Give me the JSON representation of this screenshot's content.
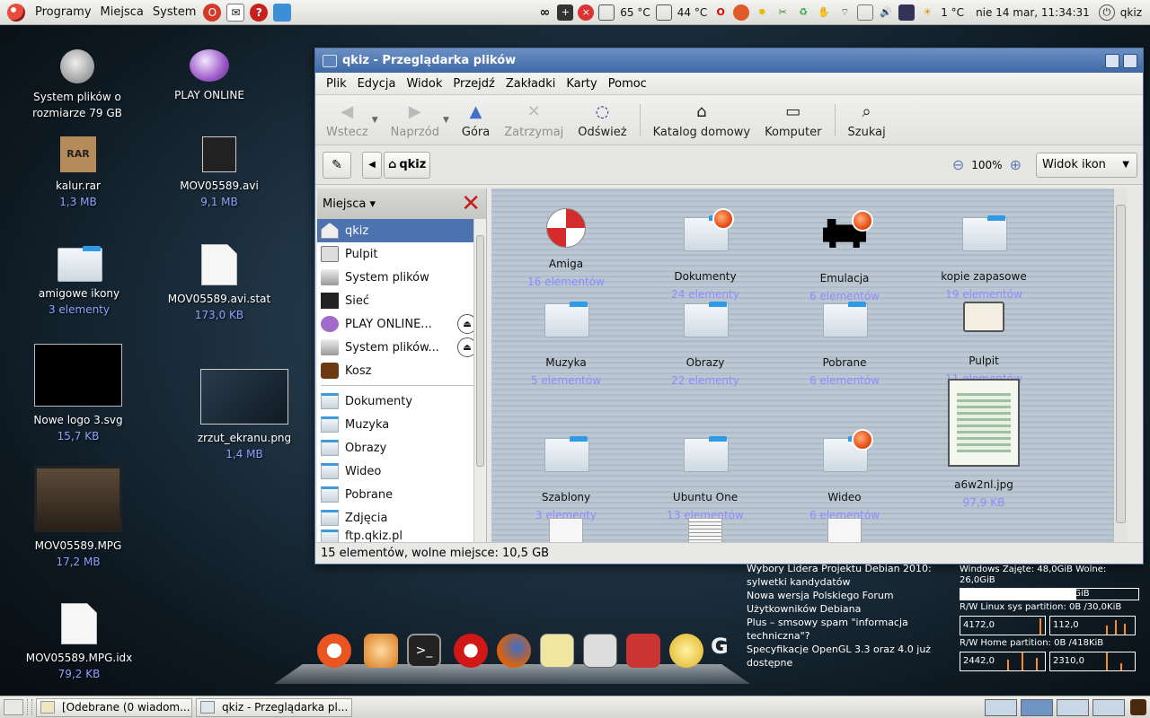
{
  "top_panel": {
    "menus": [
      "Programy",
      "Miejsca",
      "System"
    ],
    "temp1": "65 °C",
    "temp2": "44 °C",
    "weather": "1 °C",
    "clock": "nie 14 mar, 11:34:31",
    "user": "qkiz"
  },
  "desktop": {
    "icons": [
      {
        "label": "System plików o rozmiarze 79 GB",
        "sub": ""
      },
      {
        "label": "PLAY ONLINE",
        "sub": ""
      },
      {
        "label": "kalur.rar",
        "sub": "1,3 MB",
        "icon_text": "RAR"
      },
      {
        "label": "MOV05589.avi",
        "sub": "9,1 MB"
      },
      {
        "label": "amigowe ikony",
        "sub": "3 elementy"
      },
      {
        "label": "MOV05589.avi.stat",
        "sub": "173,0 KB"
      },
      {
        "label": "Nowe logo 3.svg",
        "sub": "15,7 KB"
      },
      {
        "label": "zrzut_ekranu.png",
        "sub": "1,4 MB"
      },
      {
        "label": "MOV05589.MPG",
        "sub": "17,2 MB"
      },
      {
        "label": "MOV05589.MPG.idx",
        "sub": "79,2 KB"
      }
    ]
  },
  "file_manager": {
    "title": "qkiz - Przeglądarka plików",
    "menu": [
      "Plik",
      "Edycja",
      "Widok",
      "Przejdź",
      "Zakładki",
      "Karty",
      "Pomoc"
    ],
    "toolbar": {
      "back": "Wstecz",
      "forward": "Naprzód",
      "up": "Góra",
      "stop": "Zatrzymaj",
      "reload": "Odśwież",
      "home": "Katalog domowy",
      "computer": "Komputer",
      "search": "Szukaj"
    },
    "location": {
      "path": "qkiz",
      "zoom": "100%",
      "view": "Widok ikon"
    },
    "sidebar": {
      "header": "Miejsca",
      "items": [
        {
          "label": "qkiz"
        },
        {
          "label": "Pulpit"
        },
        {
          "label": "System plików"
        },
        {
          "label": "Sieć"
        },
        {
          "label": "PLAY ONLINE..."
        },
        {
          "label": "System plików..."
        },
        {
          "label": "Kosz"
        },
        {
          "label": "Dokumenty"
        },
        {
          "label": "Muzyka"
        },
        {
          "label": "Obrazy"
        },
        {
          "label": "Wideo"
        },
        {
          "label": "Pobrane"
        },
        {
          "label": "Zdjęcia"
        },
        {
          "label": "ftp.qkiz.pl"
        }
      ]
    },
    "items": [
      {
        "name": "Amiga",
        "info": "16 elementów"
      },
      {
        "name": "Dokumenty",
        "info": "24 elementy"
      },
      {
        "name": "Emulacja",
        "info": "6 elementów"
      },
      {
        "name": "kopie zapasowe",
        "info": "19 elementów"
      },
      {
        "name": "Muzyka",
        "info": "5 elementów"
      },
      {
        "name": "Obrazy",
        "info": "22 elementy"
      },
      {
        "name": "Pobrane",
        "info": "6 elementów"
      },
      {
        "name": "Pulpit",
        "info": "11 elementów"
      },
      {
        "name": "Szablony",
        "info": "3 elementy"
      },
      {
        "name": "Ubuntu One",
        "info": "13 elementów"
      },
      {
        "name": "Wideo",
        "info": "6 elementów"
      },
      {
        "name": "a6w2nl.jpg",
        "info": "97,9 KB"
      }
    ],
    "status": "15 elementów, wolne miejsce: 10,5 GB"
  },
  "news": [
    "Wybory Lidera Projektu Debian 2010: sylwetki kandydatów",
    "Nowa wersja Polskiego Forum Użytkowników Debiana",
    "Plus – smsowy spam \"informacja techniczna\"?",
    "Specyfikacje OpenGL 3.3 oraz 4.0 już dostępne"
  ],
  "conky": {
    "windows": "Windows Zajęte: 48,0GiB Wolne: 26,0GiB",
    "windows_total": "74,0GiB",
    "windows_used_fraction": 0.65,
    "linux_rw": "R/W Linux sys partition: 0B  /30,0KiB",
    "linux_r": "4172,0",
    "linux_w": "112,0",
    "home_rw": "R/W Home partition: 0B  /418KiB",
    "home_r": "2442,0",
    "home_w": "2310,0"
  },
  "bottom_panel": {
    "tasks": [
      "[Odebrane (0 wiadom...",
      "qkiz - Przeglądarka pl..."
    ]
  },
  "colors": {
    "title_bar": "#4a73ad",
    "selected": "#4c72b0",
    "folder_tab": "#2f9be6",
    "info_text": "#8b8dff"
  }
}
